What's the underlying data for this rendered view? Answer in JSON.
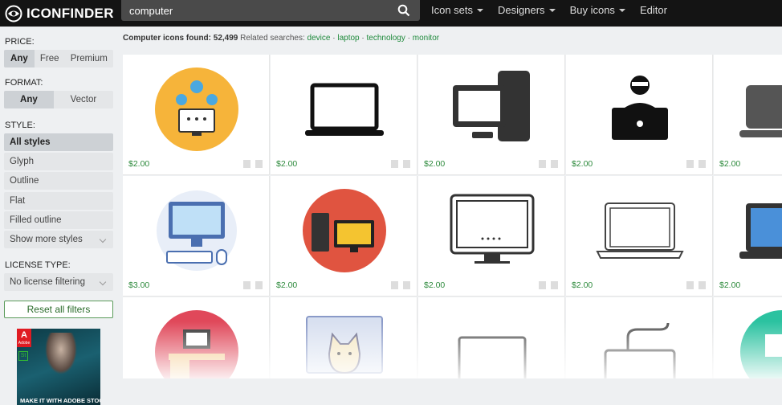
{
  "brand": {
    "name": "ICONFINDER"
  },
  "search": {
    "value": "computer"
  },
  "nav": [
    {
      "label": "Icon sets"
    },
    {
      "label": "Designers"
    },
    {
      "label": "Buy icons"
    },
    {
      "label": "Editor"
    }
  ],
  "filters": {
    "price": {
      "label": "PRICE:",
      "options": [
        "Any",
        "Free",
        "Premium"
      ],
      "selected": "Any"
    },
    "format": {
      "label": "FORMAT:",
      "options": [
        "Any",
        "Vector"
      ],
      "selected": "Any"
    },
    "style": {
      "label": "STYLE:",
      "options": [
        "All styles",
        "Glyph",
        "Outline",
        "Flat",
        "Filled outline"
      ],
      "more": "Show more styles",
      "selected": "All styles"
    },
    "license": {
      "label": "LICENSE TYPE:",
      "value": "No license filtering"
    },
    "reset": "Reset all filters"
  },
  "ad": {
    "brand": "A",
    "sub": "Adobe",
    "tag": "St",
    "text": "MAKE IT WITH ADOBE STOCK"
  },
  "results": {
    "prefix": "Computer icons found:",
    "count": "52,499",
    "related_label": "Related searches:",
    "related": [
      "device",
      "laptop",
      "technology",
      "monitor"
    ]
  },
  "icons": [
    {
      "name": "network-computer-icon",
      "price": "$2.00"
    },
    {
      "name": "laptop-outline-icon",
      "price": "$2.00"
    },
    {
      "name": "desktop-tower-icon",
      "price": "$2.00"
    },
    {
      "name": "programmer-icon",
      "price": "$2.00"
    },
    {
      "name": "laptop-glyph-icon",
      "price": "$2.00"
    },
    {
      "name": "imac-workstation-icon",
      "price": "$3.00"
    },
    {
      "name": "pc-tower-monitor-icon",
      "price": "$2.00"
    },
    {
      "name": "monitor-outline-icon",
      "price": "$2.00"
    },
    {
      "name": "laptop-outline-2-icon",
      "price": "$2.00"
    },
    {
      "name": "laptop-flat-icon",
      "price": "$2.00"
    },
    {
      "name": "desk-computer-icon",
      "price": ""
    },
    {
      "name": "cat-monitor-icon",
      "price": ""
    },
    {
      "name": "laptop-thin-icon",
      "price": ""
    },
    {
      "name": "keyboard-icon",
      "price": ""
    },
    {
      "name": "teal-circle-icon",
      "price": ""
    }
  ]
}
